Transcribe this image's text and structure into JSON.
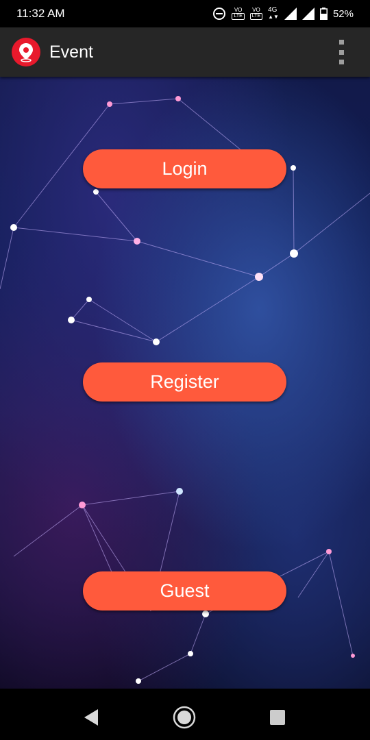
{
  "status_bar": {
    "time": "11:32 AM",
    "volte1": "VO",
    "volte2": "VO",
    "lte": "LTE",
    "network_type": "4G",
    "battery_percent": "52%",
    "icons": [
      "dnd-icon",
      "volte-icon",
      "volte-icon",
      "data-arrows-icon",
      "signal-icon",
      "signal-icon",
      "battery-icon"
    ]
  },
  "app_bar": {
    "title": "Event",
    "logo_icon": "location-pin-icon",
    "menu_icon": "more-vert-icon"
  },
  "buttons": {
    "login": "Login",
    "register": "Register",
    "guest": "Guest"
  },
  "nav_bar": {
    "icons": [
      "back-icon",
      "home-icon",
      "recents-icon"
    ]
  },
  "colors": {
    "accent": "#ff5a3c",
    "app_bar": "#262626",
    "logo": "#e8192c"
  }
}
